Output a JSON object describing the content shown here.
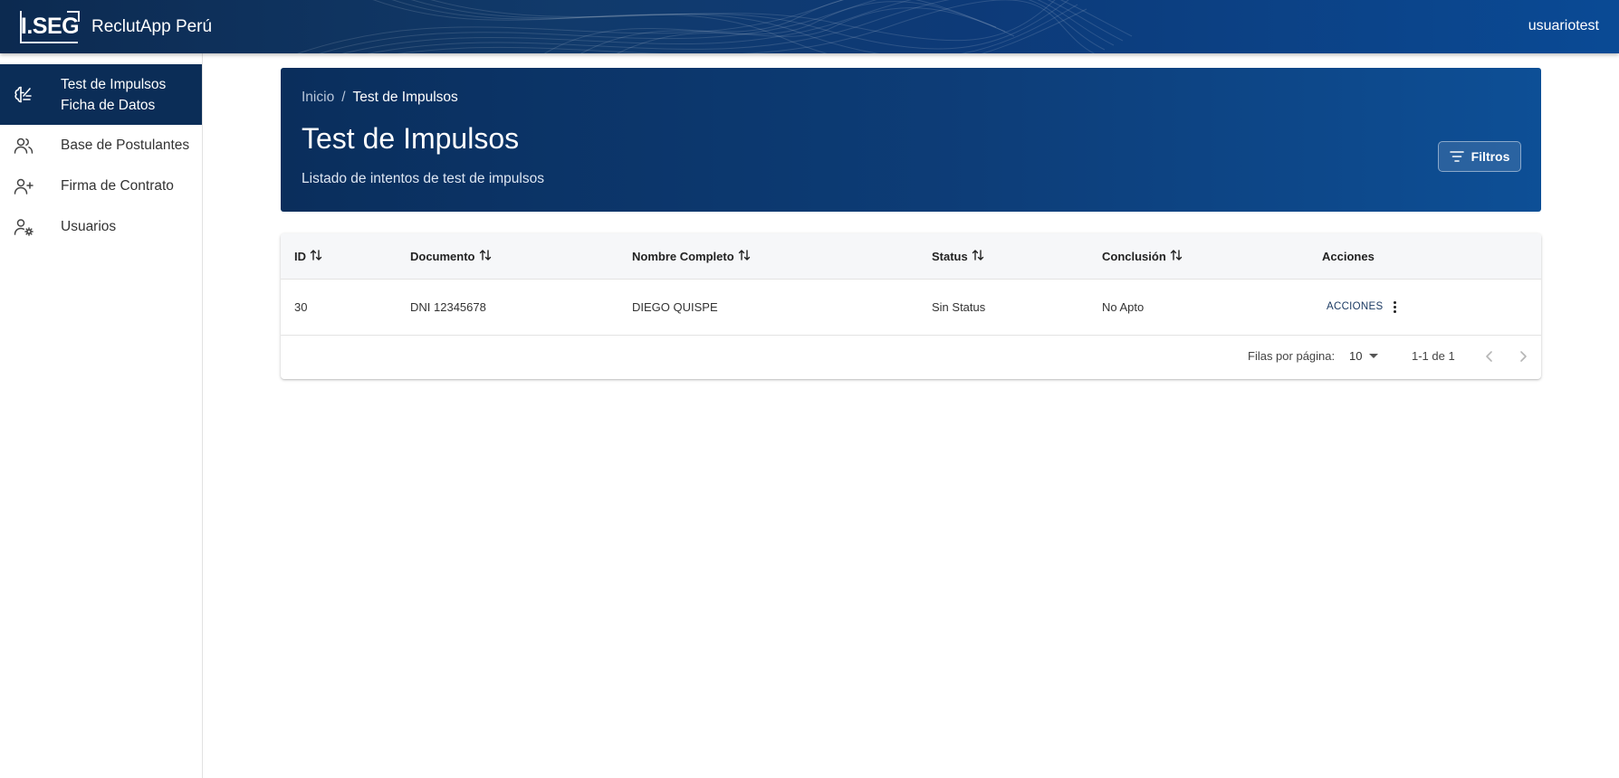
{
  "topbar": {
    "logo_text": "I.SEG",
    "app_name": "ReclutApp Perú",
    "user": "usuariotest"
  },
  "sidebar": {
    "items": [
      {
        "label_line1": "Test de Impulsos",
        "label_line2": "Ficha de Datos",
        "icon": "brain-icon",
        "active": true
      },
      {
        "label": "Base de Postulantes",
        "icon": "users-icon",
        "active": false
      },
      {
        "label": "Firma de Contrato",
        "icon": "user-plus-icon",
        "active": false
      },
      {
        "label": "Usuarios",
        "icon": "user-gear-icon",
        "active": false
      }
    ]
  },
  "header": {
    "breadcrumb": {
      "home": "Inicio",
      "separator": "/",
      "current": "Test de Impulsos"
    },
    "title": "Test de Impulsos",
    "subtitle": "Listado de intentos de test de impulsos",
    "filter_label": "Filtros"
  },
  "table": {
    "columns": [
      "ID",
      "Documento",
      "Nombre Completo",
      "Status",
      "Conclusión",
      "Acciones"
    ],
    "rows": [
      {
        "id": "30",
        "documento": "DNI 12345678",
        "nombre": "DIEGO QUISPE",
        "status": "Sin Status",
        "conclusion": "No Apto",
        "actions_label": "ACCIONES"
      }
    ]
  },
  "pagination": {
    "rows_per_page_label": "Filas por página:",
    "rows_per_page": "10",
    "range": "1-1 de 1"
  },
  "colors": {
    "topbar": "#0d3a78",
    "sidebar_active": "#0b2d57",
    "hero": "#0d3d78"
  }
}
